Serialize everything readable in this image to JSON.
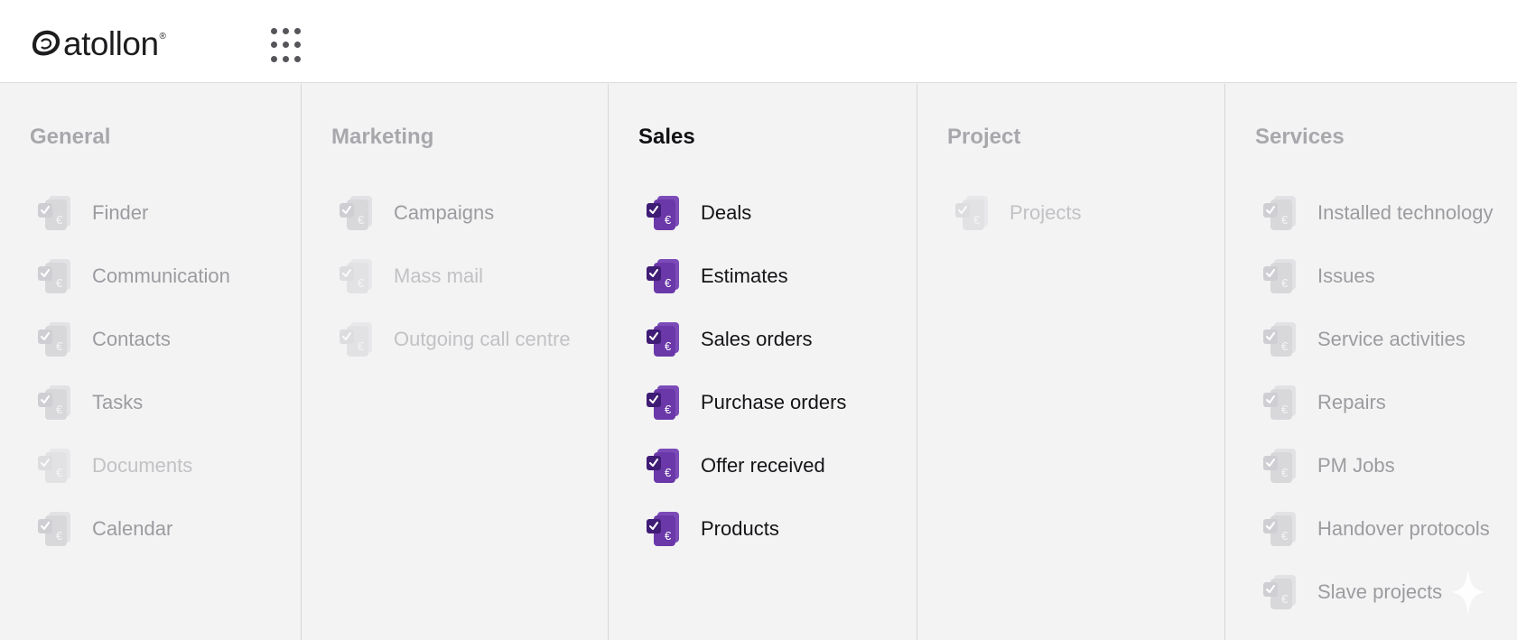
{
  "header": {
    "logo_text": "atollon",
    "logo_reg": "®",
    "apps_icon": "grid-dots-icon"
  },
  "colors": {
    "accent": "#5b2a96",
    "accent_dark": "#3d1a6e",
    "inactive_icon": "#d9d9dc",
    "active_text": "#141417",
    "inactive_text": "#9c9ca0"
  },
  "columns": [
    {
      "title": "General",
      "active": false,
      "items": [
        {
          "label": "Finder",
          "icon": "app-module-icon"
        },
        {
          "label": "Communication",
          "icon": "app-module-icon"
        },
        {
          "label": "Contacts",
          "icon": "app-module-icon"
        },
        {
          "label": "Tasks",
          "icon": "app-module-icon"
        },
        {
          "label": "Documents",
          "icon": "app-module-icon"
        },
        {
          "label": "Calendar",
          "icon": "app-module-icon"
        }
      ]
    },
    {
      "title": "Marketing",
      "active": false,
      "items": [
        {
          "label": "Campaigns",
          "icon": "app-module-icon"
        },
        {
          "label": "Mass mail",
          "icon": "app-module-icon"
        },
        {
          "label": "Outgoing call centre",
          "icon": "app-module-icon"
        }
      ]
    },
    {
      "title": "Sales",
      "active": true,
      "items": [
        {
          "label": "Deals",
          "icon": "sales-module-icon"
        },
        {
          "label": "Estimates",
          "icon": "sales-module-icon"
        },
        {
          "label": "Sales orders",
          "icon": "sales-module-icon"
        },
        {
          "label": "Purchase orders",
          "icon": "sales-module-icon"
        },
        {
          "label": "Offer received",
          "icon": "sales-module-icon"
        },
        {
          "label": "Products",
          "icon": "sales-module-icon"
        }
      ]
    },
    {
      "title": "Project",
      "active": false,
      "items": [
        {
          "label": "Projects",
          "icon": "app-module-icon"
        }
      ]
    },
    {
      "title": "Services",
      "active": false,
      "items": [
        {
          "label": "Installed technology",
          "icon": "app-module-icon"
        },
        {
          "label": "Issues",
          "icon": "app-module-icon"
        },
        {
          "label": "Service activities",
          "icon": "app-module-icon"
        },
        {
          "label": "Repairs",
          "icon": "app-module-icon"
        },
        {
          "label": "PM Jobs",
          "icon": "app-module-icon"
        },
        {
          "label": "Handover protocols",
          "icon": "app-module-icon"
        },
        {
          "label": "Slave projects",
          "icon": "app-module-icon"
        }
      ]
    }
  ]
}
